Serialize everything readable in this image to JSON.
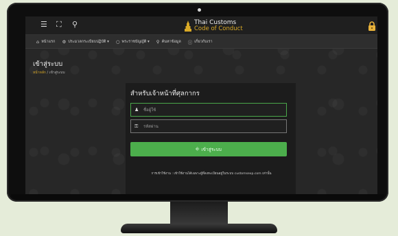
{
  "brand": {
    "line1": "Thai Customs",
    "line2": "Code of Conduct"
  },
  "nav": [
    {
      "icon": "home-icon",
      "glyph": "⌂",
      "label": "หน้าแรก"
    },
    {
      "icon": "gear-icon",
      "glyph": "⚙",
      "label": "ประมวลกระเบียบปฏิบัติ ▾"
    },
    {
      "icon": "circle-icon",
      "glyph": "○",
      "label": "พระราชบัญญัติ ▾"
    },
    {
      "icon": "search-icon",
      "glyph": "⚲",
      "label": "ค้นหาข้อมูล"
    },
    {
      "icon": "info-icon",
      "glyph": "ⓘ",
      "label": "เกี่ยวกับเรา"
    }
  ],
  "page": {
    "title": "เข้าสู่ระบบ"
  },
  "breadcrumb": {
    "home": "หน้าหลัก",
    "separator": "/",
    "current": "เข้าสู่ระบบ"
  },
  "login": {
    "title": "สำหรับเจ้าหน้าที่ศุลกากร",
    "username_placeholder": "ชื่อผู้ใช้",
    "password_placeholder": "รหัสผ่าน",
    "button_label": "เข้าสู่ระบบ",
    "terms": "การเข้าใช้งาน : เข้าใช้งานได้เฉพาะผู้ที่ลงทะเบียนอยู่ในระบบ customsexp.com เท่านั้น"
  },
  "colors": {
    "accent_gold": "#d9a926",
    "button_green": "#4cae4c",
    "screen_bg": "#272727"
  }
}
